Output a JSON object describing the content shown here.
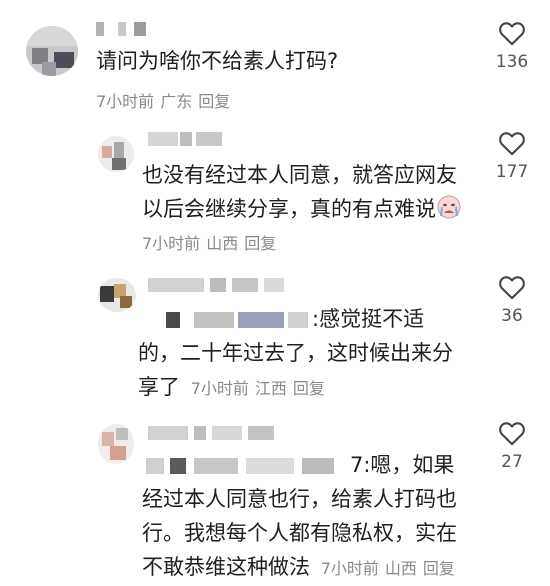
{
  "comments": [
    {
      "text": "请问为啥你不给素人打码?",
      "time": "7小时前",
      "location": "广东",
      "reply": "回复",
      "likes": "136"
    },
    {
      "line1": "也没有经过本人同意，就答应网友",
      "line2": "以后会继续分享，真的有点难说",
      "time": "7小时前",
      "location": "山西",
      "reply": "回复",
      "likes": "177",
      "emoji": "crying-face-emoji"
    },
    {
      "line1_rest": ":感觉挺不适",
      "line2": "的，二十年过去了，这时候出来分",
      "line3": "享了",
      "time": "7小时前",
      "location": "江西",
      "reply": "回复",
      "likes": "36"
    },
    {
      "line1_rest": "7:嗯，如果",
      "line2": "经过本人同意也行，给素人打码也",
      "line3": "行。我想每个人都有隐私权，实在",
      "line4": "不敢恭维这种做法",
      "time": "7小时前",
      "location": "山西",
      "reply": "回复",
      "likes": "27"
    }
  ],
  "icons": {
    "like": "heart-outline-icon"
  },
  "colors": {
    "meta": "#8a8a8a",
    "text": "#1f1f1f"
  }
}
